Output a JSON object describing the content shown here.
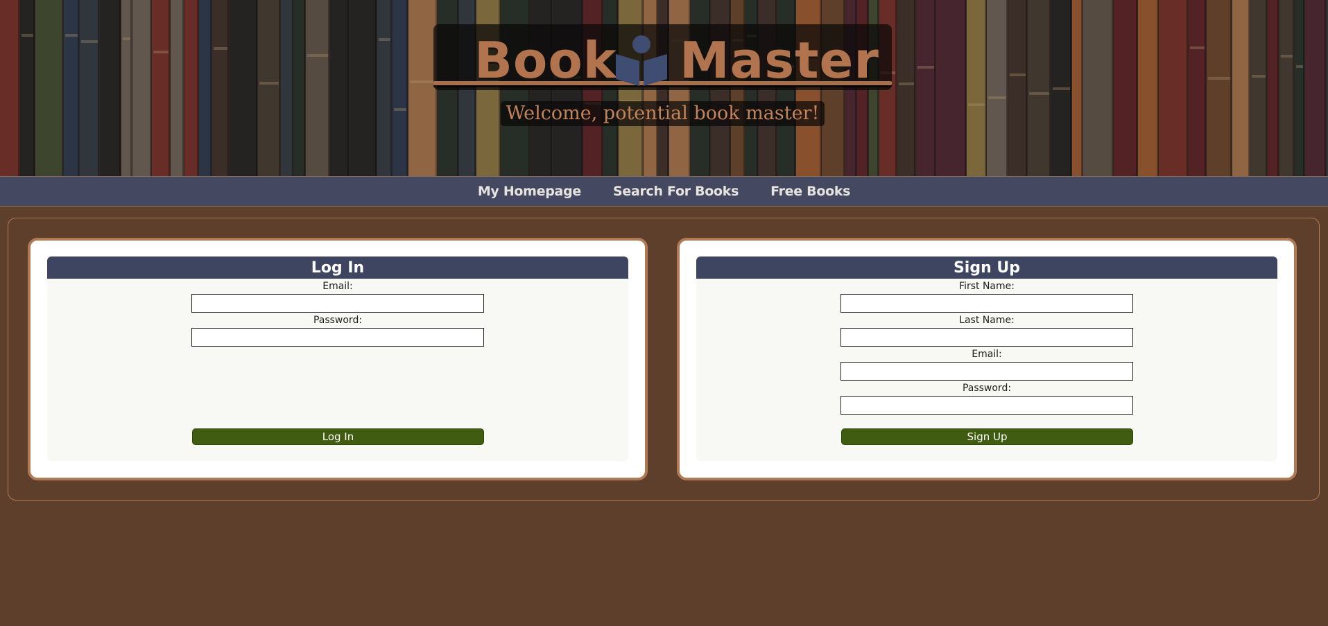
{
  "header": {
    "logo_left": "Book",
    "logo_right": "Master",
    "logo_icon": "reader-icon",
    "tagline": "Welcome, potential book master!"
  },
  "nav": {
    "items": [
      {
        "label": "My Homepage"
      },
      {
        "label": "Search For Books"
      },
      {
        "label": "Free Books"
      }
    ]
  },
  "login": {
    "title": "Log In",
    "fields": [
      {
        "label": "Email:",
        "value": "",
        "placeholder": ""
      },
      {
        "label": "Password:",
        "value": "",
        "placeholder": ""
      }
    ],
    "button": "Log In"
  },
  "signup": {
    "title": "Sign Up",
    "fields": [
      {
        "label": "First Name:",
        "value": "",
        "placeholder": ""
      },
      {
        "label": "Last Name:",
        "value": "",
        "placeholder": ""
      },
      {
        "label": "Email:",
        "value": "",
        "placeholder": ""
      },
      {
        "label": "Password:",
        "value": "",
        "placeholder": ""
      }
    ],
    "button": "Sign Up"
  },
  "colors": {
    "page_background": "#5e3f2b",
    "accent_copper": "#b2744f",
    "nav_background": "#3e4b6e",
    "card_header": "#3e4560",
    "button_green": "#3f5c10"
  }
}
